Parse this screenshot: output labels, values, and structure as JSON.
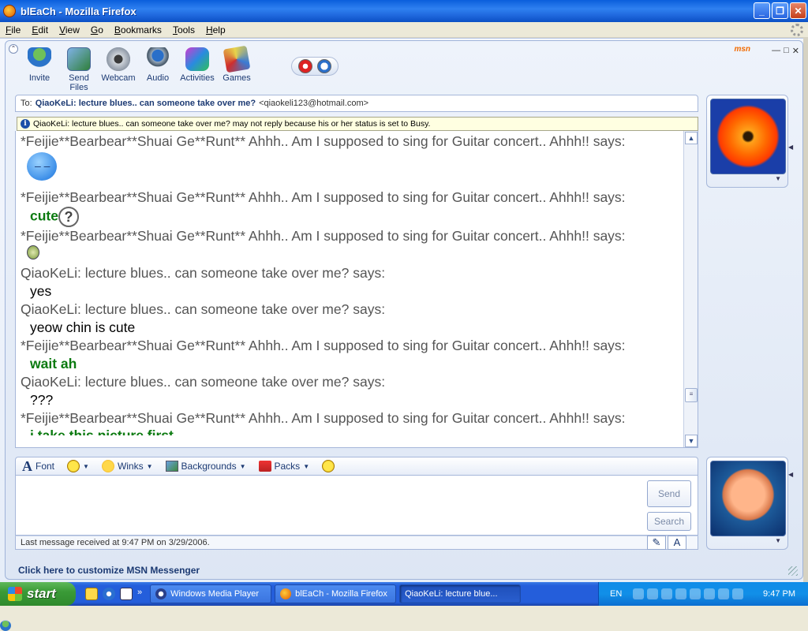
{
  "window": {
    "title": "blEaCh - Mozilla Firefox"
  },
  "firefox_menu": [
    "File",
    "Edit",
    "View",
    "Go",
    "Bookmarks",
    "Tools",
    "Help"
  ],
  "msn": {
    "logo": "msn",
    "toolbar": [
      {
        "label": "Invite",
        "icon": "invite-icon"
      },
      {
        "label": "Send Files",
        "icon": "send-files-icon"
      },
      {
        "label": "Webcam",
        "icon": "webcam-icon"
      },
      {
        "label": "Audio",
        "icon": "audio-icon"
      },
      {
        "label": "Activities",
        "icon": "activities-icon"
      },
      {
        "label": "Games",
        "icon": "games-icon"
      }
    ],
    "to": {
      "prefix": "To:",
      "name": "QiaoKeLi: lecture blues.. can someone take over me?",
      "email": "<qiaokeli123@hotmail.com>"
    },
    "busy_notice": "QiaoKeLi: lecture blues.. can someone take over me? may not reply because his or her status is set to Busy.",
    "messages": [
      {
        "sender": "*Feijie**Bearbear**Shuai Ge**Runt**  Ahhh.. Am I supposed to sing for Guitar concert.. Ahhh!! says:",
        "text": "",
        "style": "emoticon-blue"
      },
      {
        "sender": "*Feijie**Bearbear**Shuai Ge**Runt**  Ahhh.. Am I supposed to sing for Guitar concert.. Ahhh!! says:",
        "text": "cute",
        "style": "green"
      },
      {
        "sender": "*Feijie**Bearbear**Shuai Ge**Runt**  Ahhh.. Am I supposed to sing for Guitar concert.. Ahhh!! says:",
        "text": "",
        "style": "emoticon-green"
      },
      {
        "sender": "QiaoKeLi: lecture blues.. can someone take over me? says:",
        "text": "yes",
        "style": "black"
      },
      {
        "sender": "QiaoKeLi: lecture blues.. can someone take over me? says:",
        "text": "yeow chin is cute",
        "style": "black"
      },
      {
        "sender": "*Feijie**Bearbear**Shuai Ge**Runt**  Ahhh.. Am I supposed to sing for Guitar concert.. Ahhh!! says:",
        "text": "wait ah",
        "style": "green"
      },
      {
        "sender": "QiaoKeLi: lecture blues.. can someone take over me? says:",
        "text": "???",
        "style": "black"
      },
      {
        "sender": "*Feijie**Bearbear**Shuai Ge**Runt**  Ahhh.. Am I supposed to sing for Guitar concert.. Ahhh!! says:",
        "text": "i take this picture first",
        "style": "green-cut"
      }
    ],
    "compose_toolbar": {
      "font": "Font",
      "winks": "Winks",
      "backgrounds": "Backgrounds",
      "packs": "Packs"
    },
    "send_label": "Send",
    "search_label": "Search",
    "status": "Last message received at 9:47 PM on 3/29/2006.",
    "customize": "Click here to customize MSN Messenger",
    "colors": {
      "accent": "#1c3a73",
      "green_text": "#0b7a10",
      "busy_bg": "#ffffe1"
    }
  },
  "taskbar": {
    "start": "start",
    "items": [
      {
        "label": "Windows Media Player",
        "icon": "wmp"
      },
      {
        "label": "blEaCh - Mozilla Firefox",
        "icon": "ff"
      },
      {
        "label": "QiaoKeLi: lecture blue...",
        "icon": "msn"
      }
    ],
    "lang": "EN",
    "clock": "9:47 PM"
  }
}
